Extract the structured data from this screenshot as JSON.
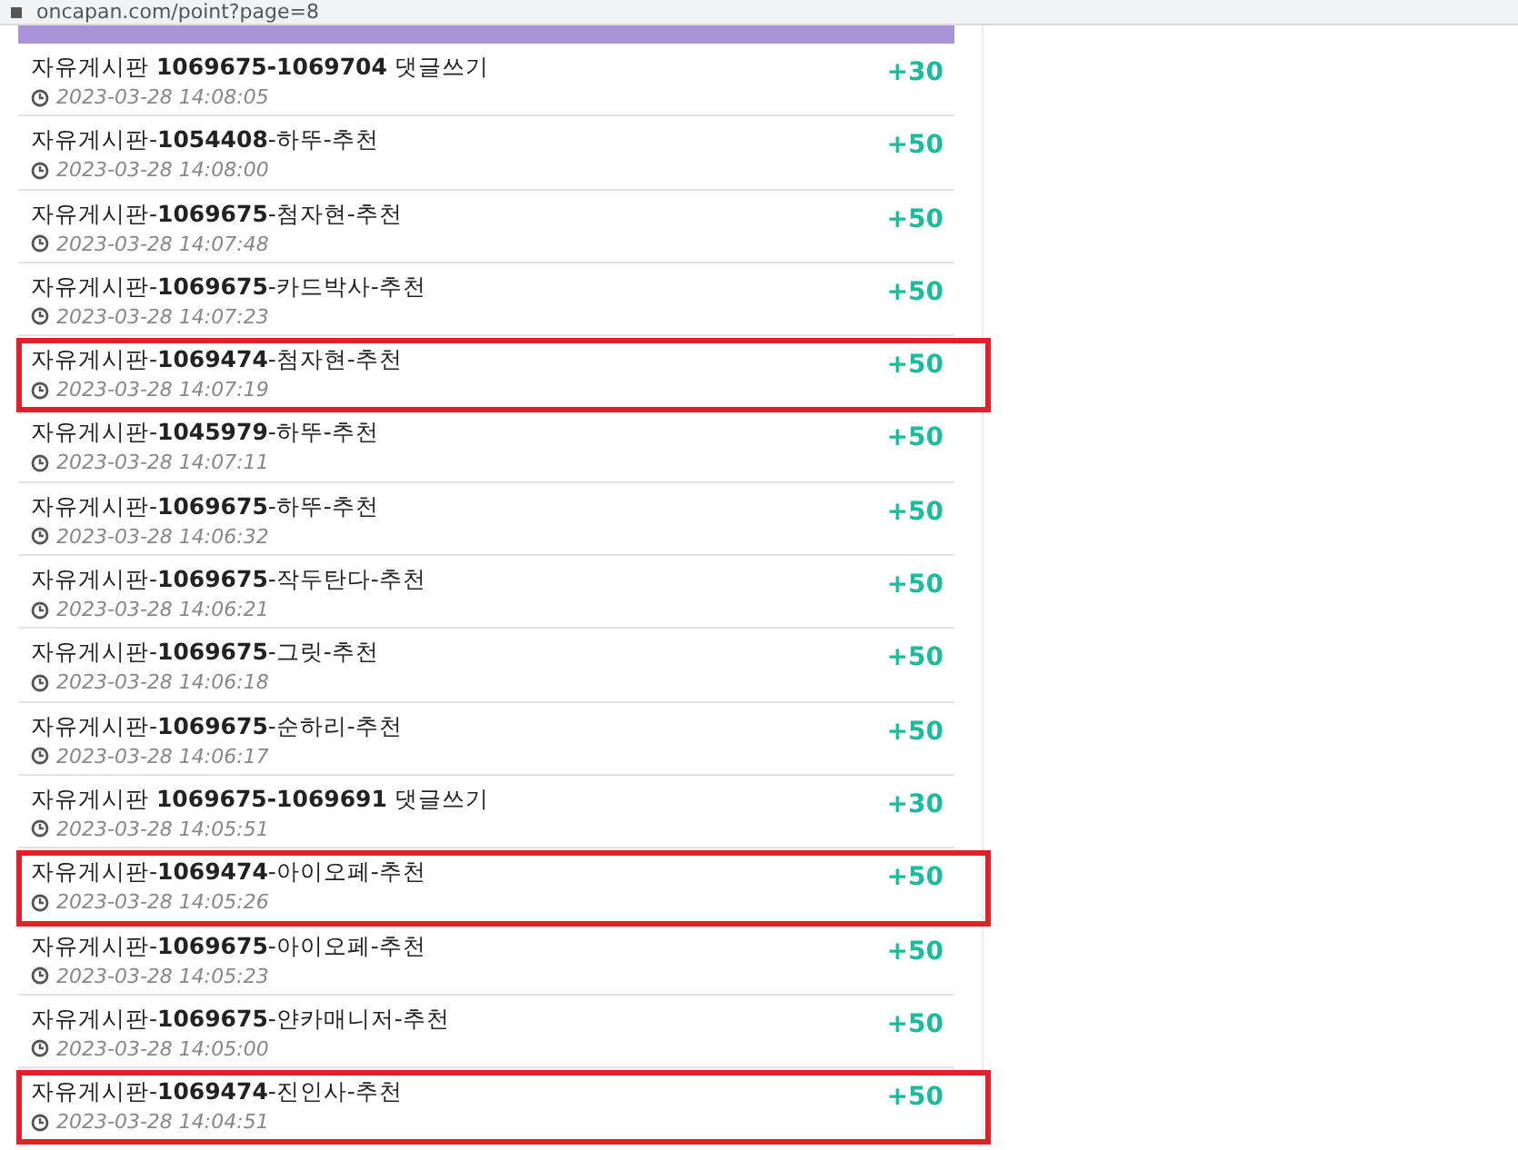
{
  "address_bar": {
    "url": "oncapan.com/point?page=8"
  },
  "entries": [
    {
      "title": "자유게시판 **1069675-1069704** 댓글쓰기",
      "time": "2023-03-28 14:08:05",
      "points": "+30",
      "highlighted": false
    },
    {
      "title": "자유게시판-**1054408**-하뚜-추천",
      "time": "2023-03-28 14:08:00",
      "points": "+50",
      "highlighted": false
    },
    {
      "title": "자유게시판-**1069675**-첨자현-추천",
      "time": "2023-03-28 14:07:48",
      "points": "+50",
      "highlighted": false
    },
    {
      "title": "자유게시판-**1069675**-카드박사-추천",
      "time": "2023-03-28 14:07:23",
      "points": "+50",
      "highlighted": false
    },
    {
      "title": "자유게시판-**1069474**-첨자현-추천",
      "time": "2023-03-28 14:07:19",
      "points": "+50",
      "highlighted": true
    },
    {
      "title": "자유게시판-**1045979**-하뚜-추천",
      "time": "2023-03-28 14:07:11",
      "points": "+50",
      "highlighted": false
    },
    {
      "title": "자유게시판-**1069675**-하뚜-추천",
      "time": "2023-03-28 14:06:32",
      "points": "+50",
      "highlighted": false
    },
    {
      "title": "자유게시판-**1069675**-작두탄다-추천",
      "time": "2023-03-28 14:06:21",
      "points": "+50",
      "highlighted": false
    },
    {
      "title": "자유게시판-**1069675**-그릿-추천",
      "time": "2023-03-28 14:06:18",
      "points": "+50",
      "highlighted": false
    },
    {
      "title": "자유게시판-**1069675**-순하리-추천",
      "time": "2023-03-28 14:06:17",
      "points": "+50",
      "highlighted": false
    },
    {
      "title": "자유게시판 **1069675-1069691** 댓글쓰기",
      "time": "2023-03-28 14:05:51",
      "points": "+30",
      "highlighted": false
    },
    {
      "title": "자유게시판-**1069474**-아이오페-추천",
      "time": "2023-03-28 14:05:26",
      "points": "+50",
      "highlighted": true
    },
    {
      "title": "자유게시판-**1069675**-아이오페-추천",
      "time": "2023-03-28 14:05:23",
      "points": "+50",
      "highlighted": false
    },
    {
      "title": "자유게시판-**1069675**-얀카매니저-추천",
      "time": "2023-03-28 14:05:00",
      "points": "+50",
      "highlighted": false
    },
    {
      "title": "자유게시판-**1069474**-진인사-추천",
      "time": "2023-03-28 14:04:51",
      "points": "+50",
      "highlighted": true
    }
  ]
}
